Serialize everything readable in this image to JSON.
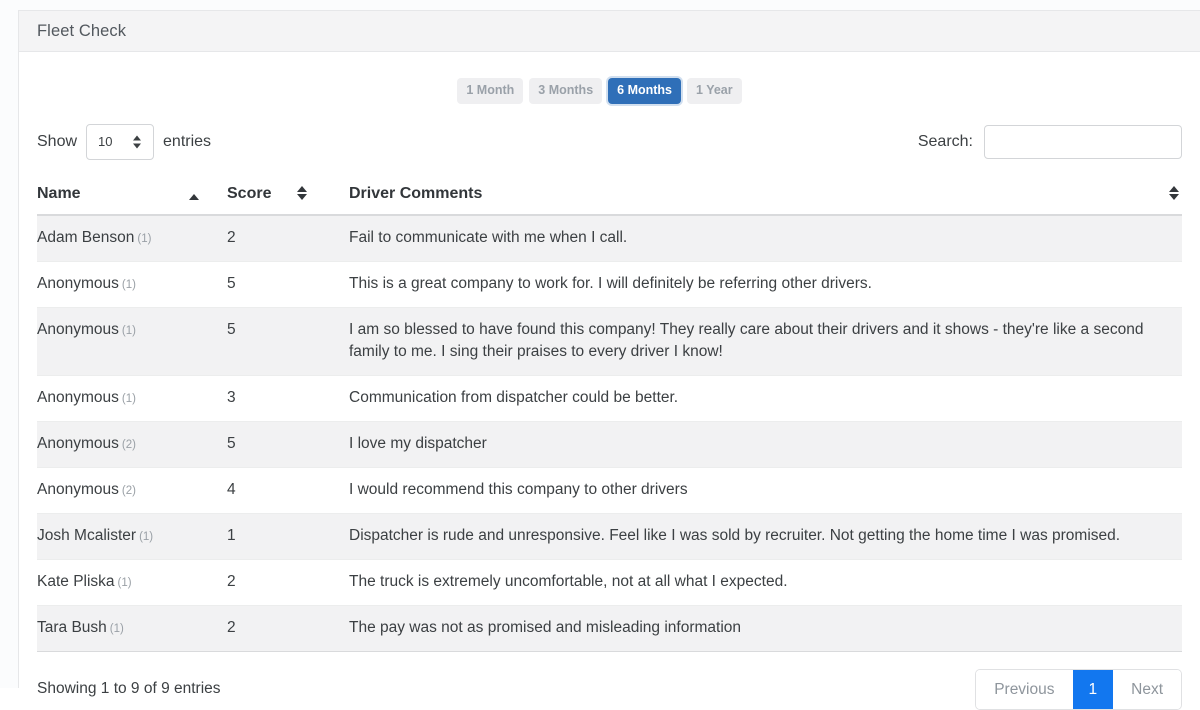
{
  "card": {
    "title": "Fleet Check"
  },
  "range_filter": {
    "options": [
      {
        "label": "1 Month",
        "active": false
      },
      {
        "label": "3 Months",
        "active": false
      },
      {
        "label": "6 Months",
        "active": true
      },
      {
        "label": "1 Year",
        "active": false
      }
    ],
    "active_color": "#2f6fb8"
  },
  "controls": {
    "show_label": "Show",
    "entries_label": "entries",
    "page_length": "10",
    "search_label": "Search:",
    "search_value": "",
    "search_placeholder": ""
  },
  "table": {
    "columns": [
      {
        "label": "Name",
        "sort": "asc"
      },
      {
        "label": "Score",
        "sort": "none"
      },
      {
        "label": "Driver Comments",
        "sort": "none"
      }
    ],
    "rows": [
      {
        "name": "Adam Benson",
        "count": "(1)",
        "score": "2",
        "comment": "Fail to communicate with me when I call."
      },
      {
        "name": "Anonymous",
        "count": "(1)",
        "score": "5",
        "comment": "This is a great company to work for. I will definitely be referring other drivers."
      },
      {
        "name": "Anonymous",
        "count": "(1)",
        "score": "5",
        "comment": "I am so blessed to have found this company! They really care about their drivers and it shows - they're like a second family to me. I sing their praises to every driver I know!"
      },
      {
        "name": "Anonymous",
        "count": "(1)",
        "score": "3",
        "comment": "Communication from dispatcher could be better."
      },
      {
        "name": "Anonymous",
        "count": "(2)",
        "score": "5",
        "comment": "I love my dispatcher"
      },
      {
        "name": "Anonymous",
        "count": "(2)",
        "score": "4",
        "comment": "I would recommend this company to other drivers"
      },
      {
        "name": "Josh Mcalister",
        "count": "(1)",
        "score": "1",
        "comment": "Dispatcher is rude and unresponsive. Feel like I was sold by recruiter. Not getting the home time I was promised."
      },
      {
        "name": "Kate Pliska",
        "count": "(1)",
        "score": "2",
        "comment": "The truck is extremely uncomfortable, not at all what I expected."
      },
      {
        "name": "Tara Bush",
        "count": "(1)",
        "score": "2",
        "comment": "The pay was not as promised and misleading information"
      }
    ]
  },
  "footer": {
    "info": "Showing 1 to 9 of 9 entries",
    "previous_label": "Previous",
    "next_label": "Next",
    "pages": [
      {
        "label": "1",
        "active": true
      }
    ],
    "active_page_color": "#1277ef"
  }
}
